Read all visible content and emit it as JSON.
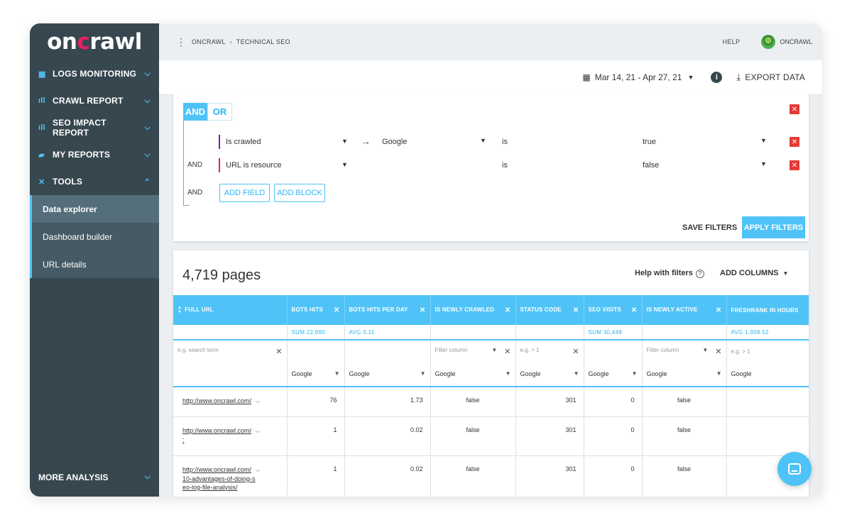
{
  "app": {
    "logo": "oncrawl"
  },
  "sidebar": {
    "items": [
      {
        "label": "LOGS MONITORING",
        "icon": "calendar-icon"
      },
      {
        "label": "CRAWL REPORT",
        "icon": "bar-chart-icon"
      },
      {
        "label": "SEO IMPACT REPORT",
        "icon": "bar-chart-icon"
      },
      {
        "label": "MY REPORTS",
        "icon": "folder-icon"
      },
      {
        "label": "TOOLS",
        "icon": "tools-icon"
      }
    ],
    "tools_sub": [
      "Data explorer",
      "Dashboard builder",
      "URL details"
    ],
    "more": "MORE ANALYSIS"
  },
  "header": {
    "breadcrumb": [
      "ONCRAWL",
      "TECHNICAL SEO"
    ],
    "help": "HELP",
    "account": "ONCRAWL"
  },
  "toolbar": {
    "date_range": "Mar 14, 21 - Apr 27, 21",
    "export": "EXPORT DATA"
  },
  "filters": {
    "and": "AND",
    "or": "OR",
    "rows": [
      {
        "conj": "",
        "field": "Is crawled",
        "bot": "Google",
        "op": "is",
        "value": "true"
      },
      {
        "conj": "AND",
        "field": "URL is resource",
        "bot": "",
        "op": "is",
        "value": "false"
      }
    ],
    "conj3": "AND",
    "add_field": "ADD FIELD",
    "add_block": "ADD BLOCK",
    "save": "SAVE FILTERS",
    "apply": "APPLY FILTERS"
  },
  "results": {
    "count": "4,719 pages",
    "help_filters": "Help with filters",
    "add_columns": "ADD COLUMNS",
    "columns": [
      "FULL URL",
      "BOTS HITS",
      "BOTS HITS PER DAY",
      "IS NEWLY CRAWLED",
      "STATUS CODE",
      "SEO VISITS",
      "IS NEWLY ACTIVE",
      "FRESHRANK IN HOURS"
    ],
    "aggregates": [
      "",
      "SUM  22,990",
      "AVG  0.11",
      "",
      "",
      "SUM  30,448",
      "",
      "AVG  1,908.52"
    ],
    "filter_placeholders": {
      "url": "e.g. search term",
      "filter_column": "Filter column",
      "gt": "e.g. > 1"
    },
    "bot": "Google",
    "rows": [
      {
        "url": "http://www.oncrawl.com/",
        "url2": "",
        "url3": "",
        "hits": "76",
        "per_day": "1.73",
        "newly_crawled": "false",
        "status": "301",
        "seo_visits": "0",
        "newly_active": "false"
      },
      {
        "url": "http://www.oncrawl.com/",
        "url2": ":",
        "url3": "",
        "hits": "1",
        "per_day": "0.02",
        "newly_crawled": "false",
        "status": "301",
        "seo_visits": "0",
        "newly_active": "false"
      },
      {
        "url": "http://www.oncrawl.com/",
        "url2": "10-advantages-of-doing-s",
        "url3": "eo-log-file-analysis/",
        "hits": "1",
        "per_day": "0.02",
        "newly_crawled": "false",
        "status": "301",
        "seo_visits": "0",
        "newly_active": "false"
      }
    ]
  }
}
